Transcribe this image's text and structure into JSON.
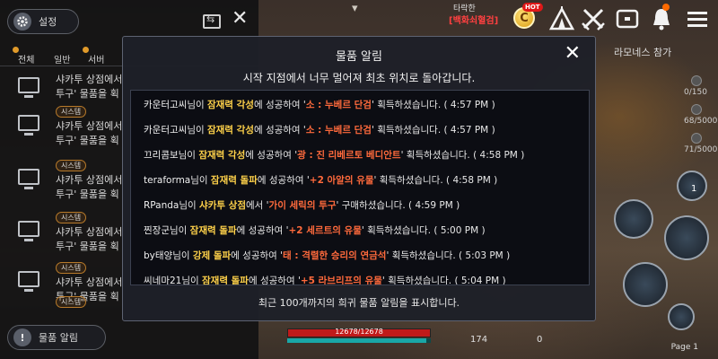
{
  "hud": {
    "top_small": "타락한",
    "top_red": "[백화쇠혈검]",
    "hot_badge": "HOT",
    "coin_glyph": "C",
    "quest_label": "라모네스 참가",
    "counters": [
      "0/150",
      "68/5000",
      "71/5000"
    ],
    "skill_count": "1",
    "page_label": "Page 1",
    "hp_text": "12678/12678",
    "hp_fraction": 1.0,
    "mp_fraction": 0.97,
    "bottom_num": "174",
    "bottom_num2": "0",
    "icons": [
      "coin-icon",
      "tent-icon",
      "crossed-swords-icon",
      "storage-box-icon",
      "bell-icon",
      "menu-icon"
    ]
  },
  "left_panel": {
    "settings_label": "설정",
    "tabs": [
      "전체",
      "일반",
      "서버"
    ],
    "rows": [
      {
        "tag": "",
        "line1": "샤카투 상점에서",
        "line2": "투구' 물품을 획"
      },
      {
        "tag": "시스템",
        "line1": "샤카투 상점에서",
        "line2": "투구' 물품을 획"
      },
      {
        "tag": "시스템",
        "line1": "샤카투 상점에서",
        "line2": "투구' 물품을 획"
      },
      {
        "tag": "시스템",
        "line1": "샤카투 상점에서",
        "line2": "투구' 물품을 획"
      },
      {
        "tag": "시스템",
        "line1": "샤카투 상점에서",
        "line2": "투구' 물품을 획"
      },
      {
        "tag": "시스템",
        "line1": "샤카투 상점에서",
        "line2": "투구' 물품을 획"
      }
    ],
    "item_alert_label": "물품 알림"
  },
  "modal": {
    "title": "물품 알림",
    "subtitle": "시작 지점에서 너무 멀어져 최초 위치로 돌아갑니다.",
    "footer": "최근 100개까지의 희귀 물품 알림을 표시합니다.",
    "close_glyph": "✕",
    "entries": [
      {
        "name": "카운터고씨",
        "p1": "님이 ",
        "action": "잠재력 각성",
        "p2": "에 성공하여 '",
        "item": "소 : 누베르 단검",
        "p3": "' 획득하셨습니다. ",
        "time": "( 4:57 PM )"
      },
      {
        "name": "카운터고씨",
        "p1": "님이 ",
        "action": "잠재력 각성",
        "p2": "에 성공하여 '",
        "item": "소 : 누베르 단검",
        "p3": "' 획득하셨습니다. ",
        "time": "( 4:57 PM )"
      },
      {
        "name": "끄리콤보",
        "p1": "님이 ",
        "action": "잠재력 각성",
        "p2": "에 성공하여 '",
        "item": "광 : 진 리베르토 베디안트",
        "p3": "' 획득하셨습니다. ",
        "time": "( 4:58 PM )"
      },
      {
        "name": "teraforma",
        "p1": "님이 ",
        "action": "잠재력 돌파",
        "p2": "에 성공하여 '",
        "item": "+2 아알의 유물",
        "p3": "' 획득하셨습니다. ",
        "time": "( 4:58 PM )"
      },
      {
        "name": "RPanda",
        "p1": "님이 ",
        "action": "샤카투 상점",
        "p2": "에서 '",
        "item": "가이 세릭의 투구",
        "p3": "' 구매하셨습니다. ",
        "time": "( 4:59 PM )"
      },
      {
        "name": "찐장군",
        "p1": "님이 ",
        "action": "잠재력 돌파",
        "p2": "에 성공하여 '",
        "item": "+2 세르트의 유물",
        "p3": "' 획득하셨습니다. ",
        "time": "( 5:00 PM )"
      },
      {
        "name": "by태양",
        "p1": "님이 ",
        "action": "강제 돌파",
        "p2": "에 성공하여 '",
        "item": "태 : 격렬한 승리의 연금석",
        "p3": "' 획득하셨습니다. ",
        "time": "( 5:03 PM )"
      },
      {
        "name": "씨네마21",
        "p1": "님이 ",
        "action": "잠재력 돌파",
        "p2": "에 성공하여 '",
        "item": "+5 라브리프의 유물",
        "p3": "' 획득하셨습니다. ",
        "time": "( 5:04 PM )"
      }
    ]
  },
  "colors": {
    "action": "#ffd24a",
    "item": "#ff6a3c",
    "panel_bg": "#1e2028",
    "border": "#5e6372"
  }
}
